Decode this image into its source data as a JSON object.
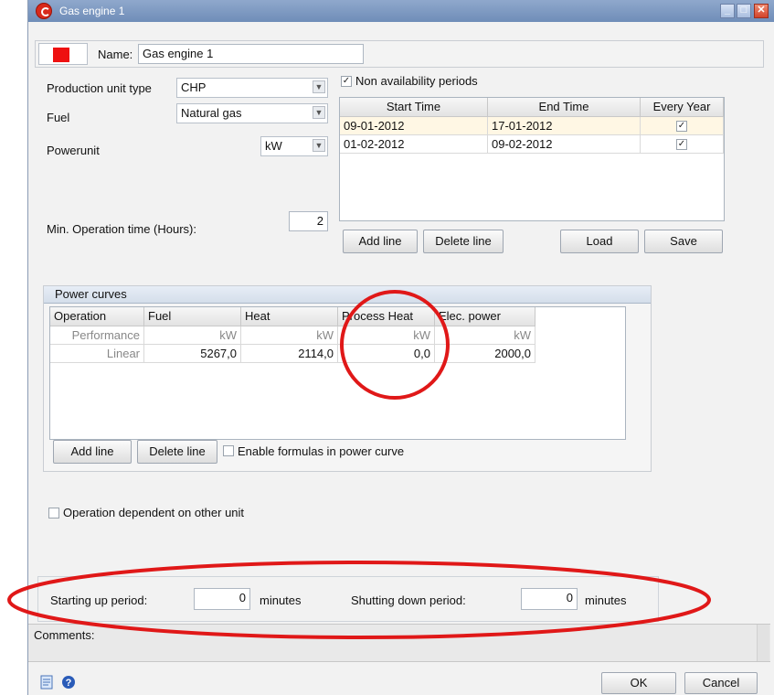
{
  "window": {
    "title": "Gas engine 1",
    "accent": "#d82a1c"
  },
  "header": {
    "name_label": "Name:",
    "name_value": "Gas engine 1",
    "color_swatch": "#ee1111"
  },
  "left": {
    "production_unit_type_label": "Production unit type",
    "production_unit_type_value": "CHP",
    "fuel_label": "Fuel",
    "fuel_value": "Natural gas",
    "powerunit_label": "Powerunit",
    "powerunit_value": "kW",
    "min_operation_label": "Min. Operation time (Hours):",
    "min_operation_value": "2"
  },
  "availability": {
    "checkbox_label": "Non availability periods",
    "checked": true,
    "columns": [
      "Start Time",
      "End Time",
      "Every Year"
    ],
    "rows": [
      {
        "start": "09-01-2012",
        "end": "17-01-2012",
        "every_year": true
      },
      {
        "start": "01-02-2012",
        "end": "09-02-2012",
        "every_year": true
      }
    ],
    "add_line": "Add line",
    "delete_line": "Delete line",
    "load": "Load",
    "save": "Save"
  },
  "power_curves": {
    "title": "Power curves",
    "columns": [
      "Operation",
      "Fuel",
      "Heat",
      "Process Heat",
      "Elec. power"
    ],
    "rows": [
      [
        "Performance",
        "kW",
        "kW",
        "kW",
        "kW"
      ],
      [
        "Linear",
        "5267,0",
        "2114,0",
        "0,0",
        "2000,0"
      ]
    ],
    "add_line": "Add line",
    "delete_line": "Delete line",
    "enable_formulas_label": "Enable formulas in power curve"
  },
  "operation_dependent_label": "Operation dependent on other unit",
  "startup": {
    "starting_up_label": "Starting up period:",
    "starting_up_value": "0",
    "starting_up_unit": "minutes",
    "shutting_down_label": "Shutting down period:",
    "shutting_down_value": "0",
    "shutting_down_unit": "minutes"
  },
  "comments_label": "Comments:",
  "footer": {
    "ok": "OK",
    "cancel": "Cancel"
  },
  "annotation_color": "#e01818"
}
